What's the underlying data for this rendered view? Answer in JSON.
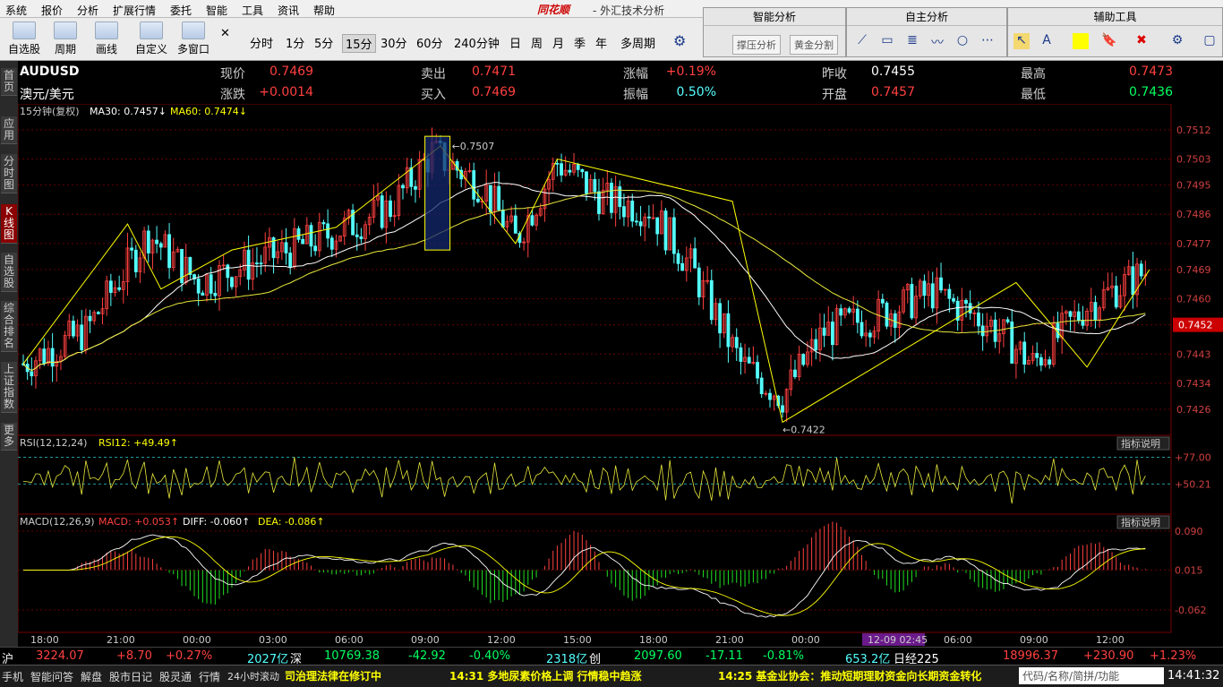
{
  "menu": [
    "系统",
    "报价",
    "分析",
    "扩展行情",
    "委托",
    "智能",
    "工具",
    "资讯",
    "帮助"
  ],
  "brand": "同花顺",
  "app_title": "- 外汇技术分析",
  "toolbar": {
    "buttons": [
      "自选股",
      "周期",
      "画线",
      "自定义",
      "多窗口"
    ],
    "periods": [
      "分时",
      "1分",
      "5分",
      "15分",
      "30分",
      "60分",
      "240分钟",
      "日",
      "周",
      "月",
      "季",
      "年",
      "多周期"
    ],
    "active_period": "15分"
  },
  "panels": {
    "smart": "智能分析",
    "smart_btns": [
      "撑压分析",
      "黄金分割"
    ],
    "self": "自主分析",
    "aux": "辅助工具"
  },
  "sidebar": [
    "首页",
    "应用",
    "分时图",
    "K线图",
    "自选股",
    "综合排名",
    "上证指数",
    "更多"
  ],
  "quote": {
    "code": "AUDUSD",
    "name": "澳元/美元",
    "row1": [
      [
        "现价",
        "0.7469"
      ],
      [
        "卖出",
        "0.7471"
      ],
      [
        "涨幅",
        "+0.19%"
      ],
      [
        "昨收",
        "0.7455"
      ],
      [
        "最高",
        "0.7473"
      ]
    ],
    "row2": [
      [
        "涨跌",
        "+0.0014"
      ],
      [
        "买入",
        "0.7469"
      ],
      [
        "振幅",
        "0.50%"
      ],
      [
        "开盘",
        "0.7457"
      ],
      [
        "最低",
        "0.7436"
      ]
    ],
    "indicator": "15分钟(复权)",
    "ma30": "MA30: 0.7457",
    "ma60": "MA60: 0.7474"
  },
  "colors": {
    "up": "#ff4040",
    "down": "#54ffff",
    "ma30": "#ffffff",
    "ma60": "#e8e83c"
  },
  "chart_data": {
    "type": "candlestick",
    "y_ticks": [
      "0.7512",
      "0.7503",
      "0.7495",
      "0.7486",
      "0.7477",
      "0.7469",
      "0.7460",
      "0.7452",
      "0.7443",
      "0.7434",
      "0.7426"
    ],
    "current_price": "0.7452",
    "annot_high": "0.7507",
    "annot_low": "0.7422",
    "x_ticks": [
      "18:00",
      "21:00",
      "00:00",
      "03:00",
      "06:00",
      "09:00",
      "12:00",
      "15:00",
      "18:00",
      "21:00",
      "00:00",
      "12-09 02:45",
      "06:00",
      "09:00",
      "12:00"
    ],
    "rsi": {
      "title": "RSI(12,12,24)",
      "value": "RSI12: +49.49",
      "ticks": [
        "+77.00",
        "+50.21"
      ]
    },
    "macd": {
      "title": "MACD(12,26,9)",
      "macd": "MACD: +0.053",
      "diff": "DIFF: -0.060",
      "dea": "DEA: -0.086",
      "ticks": [
        "0.090",
        "0.015",
        "-0.062"
      ]
    },
    "explain": "指标说明"
  },
  "status": {
    "sh": "沪",
    "sh_val": "3224.07",
    "sh_chg": "+8.70",
    "sh_pct": "+0.27%",
    "sh_amt": "2027亿",
    "sz": "深",
    "sz_val": "10769.38",
    "sz_chg": "-42.92",
    "sz_pct": "-0.40%",
    "sz_amt": "2318亿",
    "cy": "创",
    "cy_val": "2097.60",
    "cy_chg": "-17.11",
    "cy_pct": "-0.81%",
    "cy_amt": "653.2亿",
    "nk": "日经225",
    "nk_val": "18996.37",
    "nk_chg": "+230.90",
    "nk_pct": "+1.23%"
  },
  "bottom": {
    "items": [
      "手机",
      "智能问答",
      "解盘",
      "股市日记",
      "股灵通",
      "行情",
      "24小时滚动"
    ],
    "news1": "司治理法律在修订中",
    "news2": "14:31 多地尿素价格上调 行情稳中趋涨",
    "news3": "14:25 基金业协会：推动短期理财资金向长期资金转化",
    "search": "代码/名称/简拼/功能",
    "time": "14:41:32"
  }
}
